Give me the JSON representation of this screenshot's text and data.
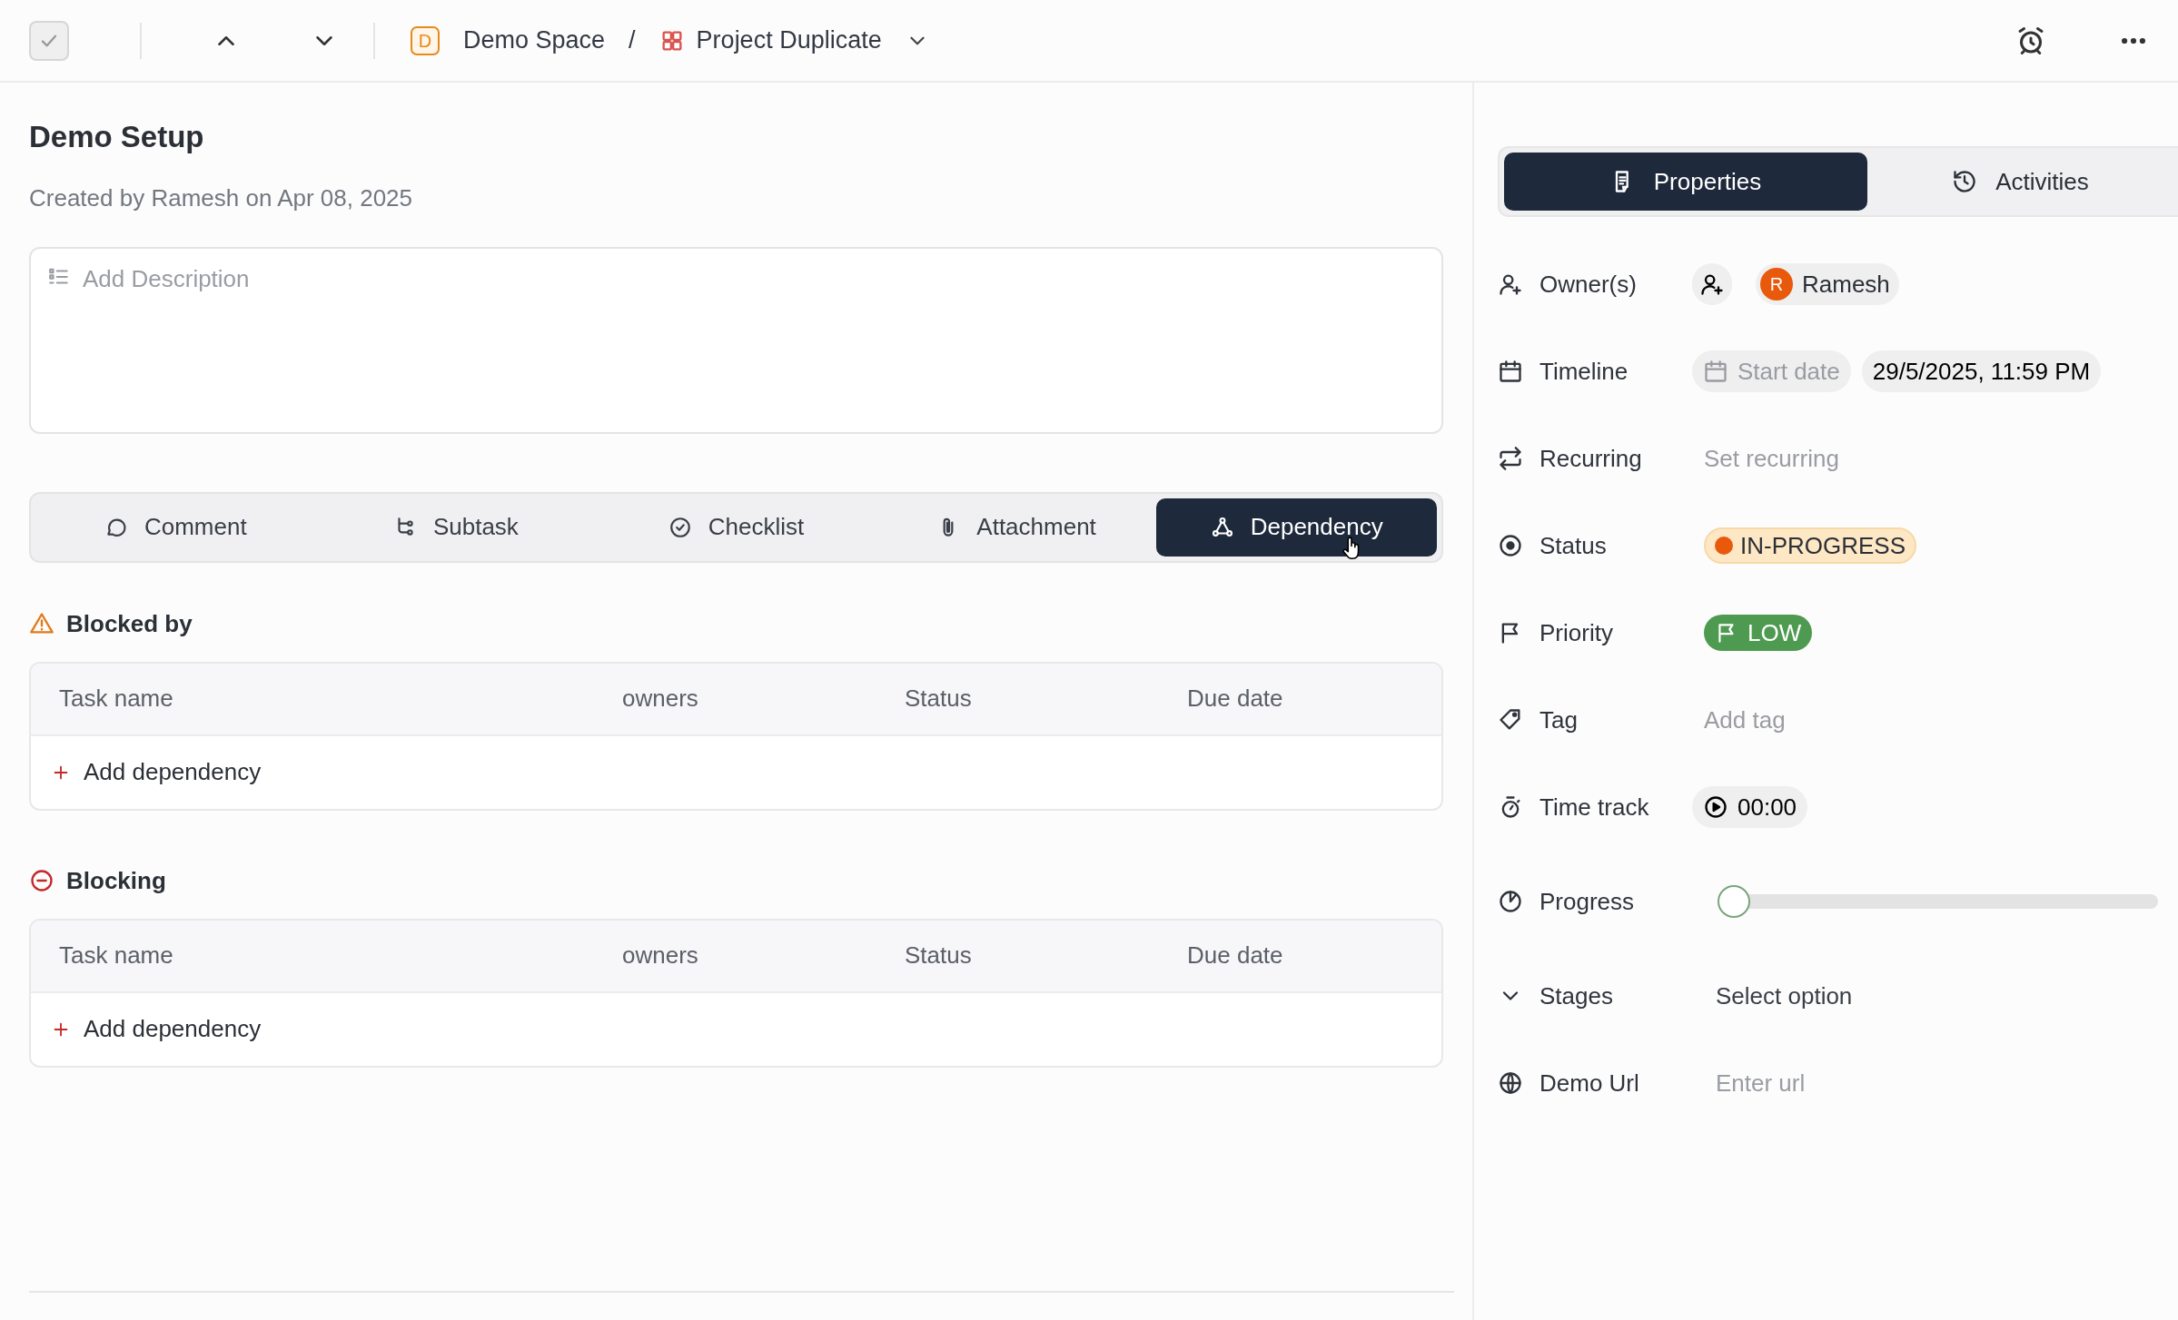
{
  "toolbar": {
    "breadcrumb": [
      {
        "kind": "space",
        "badge": "D",
        "label": "Demo Space"
      },
      {
        "kind": "project",
        "label": "Project Duplicate"
      }
    ],
    "separator": "/"
  },
  "task": {
    "completed": false,
    "title": "Demo Setup",
    "created": "Created by Ramesh on Apr 08, 2025",
    "description": {
      "placeholder": "Add Description"
    }
  },
  "tabs": [
    {
      "label": "Comment",
      "selected": false
    },
    {
      "label": "Subtask",
      "selected": false
    },
    {
      "label": "Checklist",
      "selected": false
    },
    {
      "label": "Attachment",
      "selected": false
    },
    {
      "label": "Dependency",
      "selected": true
    }
  ],
  "sections": [
    {
      "kind": "blocked",
      "title": "Blocked by",
      "columns": [
        "Task name",
        "owners",
        "Status",
        "Due date"
      ],
      "add_label": "Add dependency"
    },
    {
      "kind": "blocking",
      "title": "Blocking",
      "columns": [
        "Task name",
        "owners",
        "Status",
        "Due date"
      ],
      "add_label": "Add dependency"
    }
  ],
  "panel_tabs": [
    {
      "label": "Properties",
      "selected": true
    },
    {
      "label": "Activities",
      "selected": false
    }
  ],
  "properties": [
    {
      "kind": "people",
      "label": "Owner(s)",
      "people": [
        {
          "initial": "R",
          "name": "Ramesh"
        }
      ]
    },
    {
      "kind": "dates",
      "label": "Timeline",
      "start": {
        "placeholder": "Start date"
      },
      "end": "29/5/2025, 11:59 PM"
    },
    {
      "kind": "recurrence",
      "label": "Recurring",
      "placeholder": "Set recurring"
    },
    {
      "kind": "status",
      "label": "Status",
      "value": "IN-PROGRESS"
    },
    {
      "kind": "priority",
      "label": "Priority",
      "value": "LOW"
    },
    {
      "kind": "tag",
      "label": "Tag",
      "placeholder": "Add tag"
    },
    {
      "kind": "timer",
      "label": "Time track",
      "value": "00:00"
    },
    {
      "kind": "slider",
      "label": "Progress",
      "level": 0
    },
    {
      "kind": "select",
      "label": "Stages",
      "placeholder": "Select option"
    },
    {
      "kind": "url",
      "label": "Demo Url",
      "placeholder": "Enter url"
    }
  ]
}
